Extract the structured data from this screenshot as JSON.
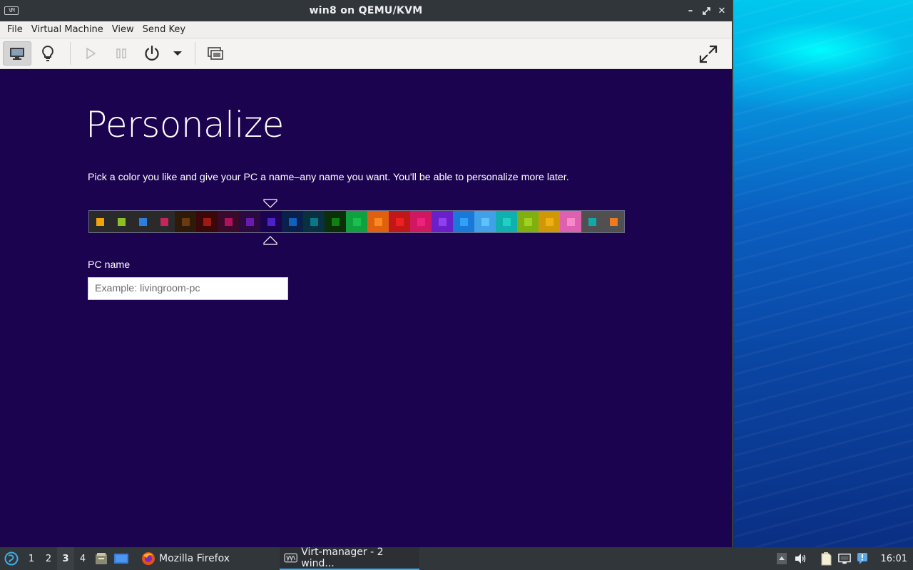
{
  "window": {
    "title": "win8 on QEMU/KVM",
    "app_icon_text": "VM",
    "controls": {
      "minimize": "–",
      "restore": "⤢",
      "close": "✕"
    }
  },
  "menu": {
    "items": [
      "File",
      "Virtual Machine",
      "View",
      "Send Key"
    ]
  },
  "toolbar": {
    "buttons": [
      "monitor-icon",
      "lightbulb-icon",
      "play-icon",
      "pause-icon",
      "power-icon",
      "dropdown-arrow-icon",
      "screenshot-icon"
    ],
    "fullscreen": "fullscreen-icon"
  },
  "guest": {
    "title": "Personalize",
    "instructions": "Pick a color you like and give your PC a name–any name you want. You'll be able to personalize more later.",
    "selected_color_index": 8,
    "colors": [
      {
        "bg": "#2a2a2a",
        "fg": "#f0a30a"
      },
      {
        "bg": "#2a2a2a",
        "fg": "#8cbf26"
      },
      {
        "bg": "#2a2a2a",
        "fg": "#2d7ee0"
      },
      {
        "bg": "#2a2a2a",
        "fg": "#c1275a"
      },
      {
        "bg": "#2e1a08",
        "fg": "#6b3a10"
      },
      {
        "bg": "#3a0808",
        "fg": "#a01a10"
      },
      {
        "bg": "#3a0a2a",
        "fg": "#b01060"
      },
      {
        "bg": "#2a0a40",
        "fg": "#6a1ab0"
      },
      {
        "bg": "#1b0350",
        "fg": "#4b22c8"
      },
      {
        "bg": "#08204a",
        "fg": "#1060c0"
      },
      {
        "bg": "#083040",
        "fg": "#087888"
      },
      {
        "bg": "#0a3008",
        "fg": "#108010"
      },
      {
        "bg": "#10a040",
        "fg": "#18c050"
      },
      {
        "bg": "#e06010",
        "fg": "#f88a20"
      },
      {
        "bg": "#c01818",
        "fg": "#f02020"
      },
      {
        "bg": "#d01860",
        "fg": "#f02080"
      },
      {
        "bg": "#6a20c8",
        "fg": "#9040f0"
      },
      {
        "bg": "#1a78d8",
        "fg": "#30a0f8"
      },
      {
        "bg": "#40a0e8",
        "fg": "#60c0f8"
      },
      {
        "bg": "#10b0b0",
        "fg": "#20d0c0"
      },
      {
        "bg": "#80b010",
        "fg": "#a0d020"
      },
      {
        "bg": "#d09808",
        "fg": "#f0b010"
      },
      {
        "bg": "#e060b0",
        "fg": "#f888c8"
      },
      {
        "bg": "#505050",
        "fg": "#10a8a8"
      },
      {
        "bg": "#505050",
        "fg": "#f07820"
      }
    ],
    "pc_name_label": "PC name",
    "pc_name_placeholder": "Example: livingroom-pc",
    "pc_name_value": ""
  },
  "taskbar": {
    "workspaces": [
      "1",
      "2",
      "3",
      "4"
    ],
    "active_workspace": "3",
    "tasks": [
      {
        "label": "Mozilla Firefox",
        "icon": "firefox-icon"
      },
      {
        "label": "Virt-manager - 2 wind...",
        "icon": "virt-manager-icon"
      }
    ],
    "clock": "16:01"
  }
}
